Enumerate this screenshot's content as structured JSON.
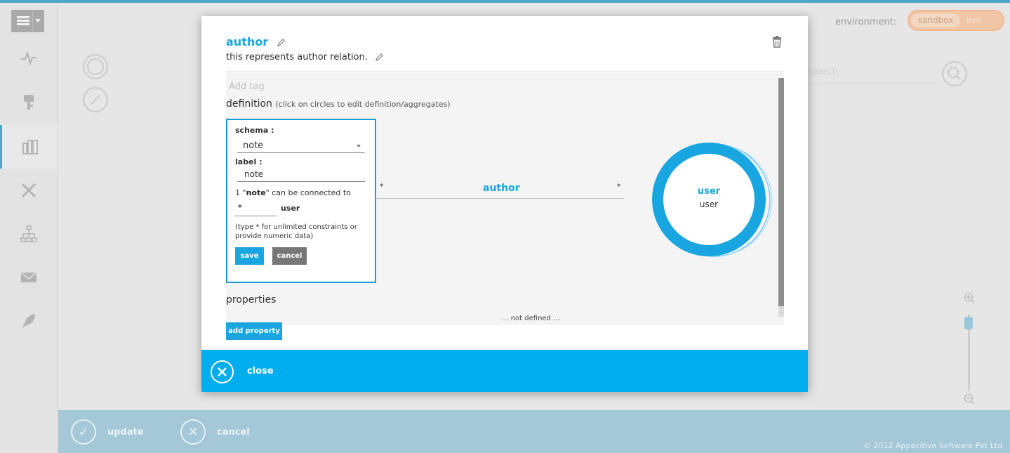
{
  "environment": {
    "label": "environment:",
    "options": [
      "sandbox",
      "live"
    ],
    "selected": "sandbox"
  },
  "search": {
    "placeholder": "search"
  },
  "sidebar": {
    "items": [
      {
        "icon": "activity-icon"
      },
      {
        "icon": "key-icon"
      },
      {
        "icon": "schema-icon",
        "active": true
      },
      {
        "icon": "tools-icon"
      },
      {
        "icon": "hierarchy-icon"
      },
      {
        "icon": "mail-icon"
      },
      {
        "icon": "rocket-icon"
      }
    ]
  },
  "modal": {
    "title": "author",
    "description": "this represents author relation.",
    "add_tag_placeholder": "Add tag",
    "definition_heading": "definition",
    "definition_hint": "(click on circles to edit definition/aggregates)",
    "form": {
      "schema_label": "schema :",
      "schema_value": "note",
      "label_label": "label :",
      "label_value": "note",
      "connection_prefix": "1 \"",
      "connection_bold": "note",
      "connection_suffix": "\" can be connected to",
      "multiplicity": "*",
      "target": "user",
      "help": "(type * for unlimited constraints or provide numeric data)",
      "save": "save",
      "cancel": "cancel"
    },
    "relation": {
      "left_multiplicity": "*",
      "right_multiplicity": "*",
      "label": "author"
    },
    "node": {
      "schema": "user",
      "label": "user"
    },
    "properties_heading": "properties",
    "properties_faded": "... not defined ...",
    "add_property": "add property",
    "close": "close"
  },
  "bottombar": {
    "update": "update",
    "cancel": "cancel",
    "copyright": "© 2012 Appacitive Software Pvt Ltd"
  },
  "colors": {
    "accent": "#19a6e0",
    "footer": "#00aeef",
    "bottombar": "#a4c8d8"
  }
}
